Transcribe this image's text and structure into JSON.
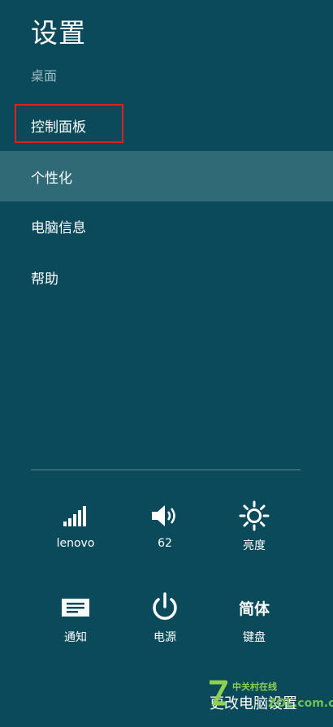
{
  "header": {
    "title": "设置",
    "subtitle": "桌面"
  },
  "menu": {
    "items": [
      {
        "label": "控制面板",
        "highlighted_box": true
      },
      {
        "label": "个性化",
        "selected": true
      },
      {
        "label": "电脑信息"
      },
      {
        "label": "帮助"
      }
    ]
  },
  "quick": {
    "network": {
      "label": "lenovo",
      "icon": "signal-bars-icon"
    },
    "volume": {
      "label": "62",
      "icon": "speaker-icon"
    },
    "brightness": {
      "label": "亮度",
      "icon": "sun-icon"
    },
    "notifications": {
      "label": "通知",
      "icon": "notification-icon"
    },
    "power": {
      "label": "电源",
      "icon": "power-icon"
    },
    "keyboard": {
      "label": "键盘",
      "value": "简体"
    }
  },
  "footer": {
    "change_settings": "更改电脑设置"
  },
  "watermark": {
    "text": "中关村在线",
    "url": "ZOL.com.cn"
  },
  "colors": {
    "background": "#0b4a5a",
    "selected": "#2f6a76",
    "highlight_border": "#e0201e"
  }
}
